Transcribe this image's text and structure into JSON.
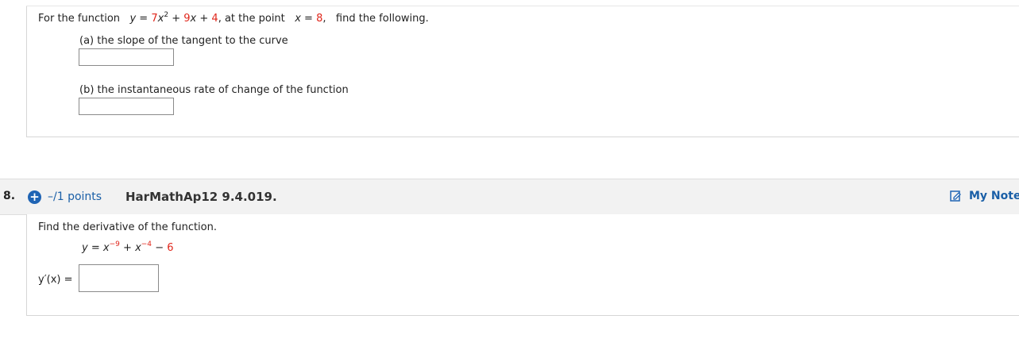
{
  "q7": {
    "prompt_prefix": "For the function",
    "fn_y": "y",
    "fn_eq": "=",
    "fn_c1": "7",
    "fn_x1": "x",
    "fn_exp1": "2",
    "fn_plus1": "+",
    "fn_c2": "9",
    "fn_x2": "x",
    "fn_plus2": "+",
    "fn_c3": "4",
    "after_fn": ", at the point",
    "pt_x": "x",
    "pt_eq": "=",
    "pt_val": "8",
    "pt_comma": ",",
    "prompt_suffix": "find the following.",
    "part_a": "(a) the slope of the tangent to the curve",
    "part_a_value": "",
    "part_b": "(b) the instantaneous rate of change of the function",
    "part_b_value": ""
  },
  "q8": {
    "number": "8.",
    "points": "–/1 points",
    "code": "HarMathAp12 9.4.019.",
    "notes": "My Note",
    "instruction": "Find the derivative of the function.",
    "eq_y": "y",
    "eq_eq": "=",
    "eq_x1": "x",
    "eq_exp1": "−9",
    "eq_plus": "+",
    "eq_x2": "x",
    "eq_exp2": "−4",
    "eq_minus": "−",
    "eq_c": "6",
    "answer_label": "y′(x) =",
    "answer_value": ""
  },
  "colors": {
    "accent": "#1f64b4",
    "red": "#e0261b",
    "link": "#1a5fa7"
  },
  "icons": {
    "expand": "plus-circle-icon",
    "notes": "note-edit-icon"
  }
}
